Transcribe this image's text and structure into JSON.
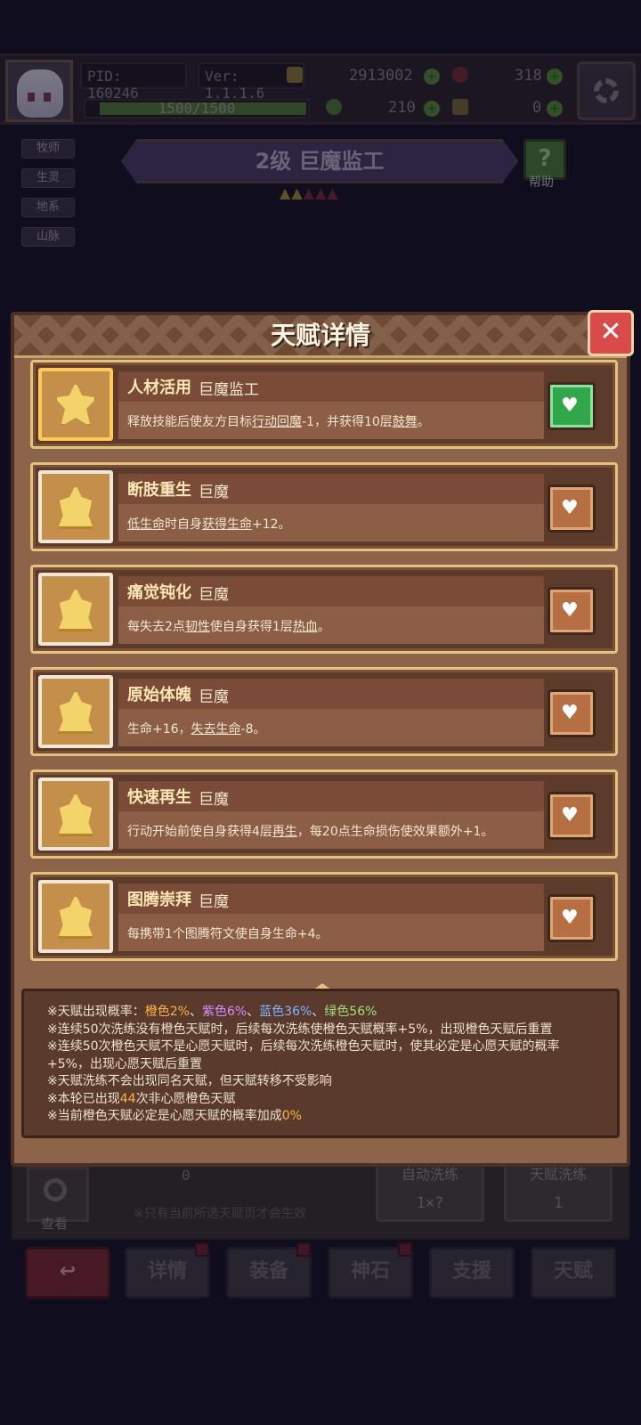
{
  "hud": {
    "pid": "PID: 160246",
    "version": "Ver: 1.1.1.6",
    "gold": "2913002",
    "gems": "318",
    "hp": "1500/1500",
    "hp_fraction": 1.0,
    "clover": "210",
    "boots": "0"
  },
  "tags": [
    "牧师",
    "生灵",
    "地系",
    "山脉"
  ],
  "hero": {
    "banner": "2级  巨魔监工",
    "help_label": "帮助",
    "stars_on": 2,
    "stars_total": 5
  },
  "modal": {
    "title": "天赋详情",
    "close": "✕",
    "talents": [
      {
        "name": "人材活用",
        "type": "巨魔监工",
        "wished": true,
        "icon": "star-icon",
        "desc": [
          {
            "t": "释放技能后使友方目标"
          },
          {
            "t": "行动回魔",
            "u": true
          },
          {
            "t": "-1，并获得10层"
          },
          {
            "t": "鼓舞",
            "u": true
          },
          {
            "t": "。"
          }
        ]
      },
      {
        "name": "断肢重生",
        "type": "巨魔",
        "wished": false,
        "icon": "crown-icon",
        "desc": [
          {
            "t": "低生命",
            "u": true
          },
          {
            "t": "时自身"
          },
          {
            "t": "获得生命",
            "u": true
          },
          {
            "t": "+12。"
          }
        ]
      },
      {
        "name": "痛觉钝化",
        "type": "巨魔",
        "wished": false,
        "icon": "crown-icon",
        "desc": [
          {
            "t": "每失去2点"
          },
          {
            "t": "韧性",
            "u": true
          },
          {
            "t": "使自身获得1层"
          },
          {
            "t": "热血",
            "u": true
          },
          {
            "t": "。"
          }
        ]
      },
      {
        "name": "原始体魄",
        "type": "巨魔",
        "wished": false,
        "icon": "crown-icon",
        "desc": [
          {
            "t": "生命+16，"
          },
          {
            "t": "失去生命",
            "u": true
          },
          {
            "t": "-8。"
          }
        ]
      },
      {
        "name": "快速再生",
        "type": "巨魔",
        "wished": false,
        "icon": "crown-icon",
        "desc": [
          {
            "t": "行动开始前使自身获得4层"
          },
          {
            "t": "再生",
            "u": true
          },
          {
            "t": "，每20点生命损伤使效果额外+1。"
          }
        ]
      },
      {
        "name": "图腾崇拜",
        "type": "巨魔",
        "wished": false,
        "icon": "crown-icon",
        "desc": [
          {
            "t": "每携带1个图腾符文使自身生命+4。"
          }
        ]
      }
    ],
    "info": {
      "line1_prefix": "※天赋出现概率：",
      "orange": "橙色2%",
      "sep": "、",
      "purple": "紫色6%",
      "blue": "蓝色36%",
      "green": "绿色56%",
      "line2": "※连续50次洗练没有橙色天赋时，后续每次洗练使橙色天赋概率+5%，出现橙色天赋后重置",
      "line3": "※连续50次橙色天赋不是心愿天赋时，后续每次洗练橙色天赋时，使其必定是心愿天赋的概率+5%，出现心愿天赋后重置",
      "line4": "※天赋洗练不会出现同名天赋，但天赋转移不受影响",
      "line5_a": "※本轮已出现",
      "line5_num": "44",
      "line5_b": "次非心愿橙色天赋",
      "line6_a": "※当前橙色天赋必定是心愿天赋的概率加成",
      "line6_num": "0%"
    }
  },
  "behind": {
    "search_label": "查看",
    "pouch_count": "0",
    "hint": "※只有当前所选天赋页才会生效",
    "auto_shuffle": "自动洗练",
    "auto_cost": "1×?",
    "shuffle": "天赋洗练",
    "shuffle_cost": "1"
  },
  "nav": {
    "back": "↩",
    "items": [
      "详情",
      "装备",
      "神石",
      "支援",
      "天赋"
    ]
  },
  "colors": {
    "panel": "#8b6449",
    "gold_border": "#e2c27c",
    "wish_on": "#2fa74a"
  }
}
